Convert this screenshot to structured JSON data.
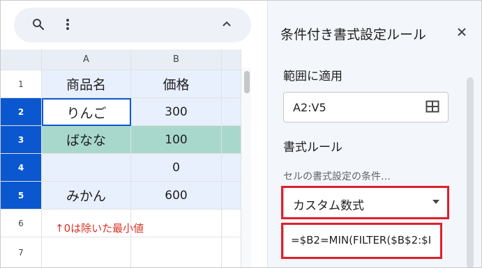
{
  "toolbar": {
    "search_icon": "search-icon",
    "more_icon": "more-vert-icon",
    "collapse_icon": "chevron-up-icon"
  },
  "sheet": {
    "columns": [
      "A",
      "B"
    ],
    "rows": [
      "1",
      "2",
      "3",
      "4",
      "5",
      "6",
      "7"
    ],
    "cells": {
      "A1": "商品名",
      "B1": "価格",
      "A2": "りんご",
      "B2": "300",
      "A3": "ばなな",
      "B3": "100",
      "A4": "",
      "B4": "0",
      "A5": "みかん",
      "B5": "600"
    },
    "note": "↑0は除いた最小値",
    "highlight_color": "#a8d8cc",
    "note_color": "#d93025"
  },
  "panel": {
    "title": "条件付き書式設定ルール",
    "range_label": "範囲に適用",
    "range_value": "A2:V5",
    "format_rules_label": "書式ルール",
    "condition_label": "セルの書式設定の条件…",
    "condition_value": "カスタム数式",
    "formula_value": "=$B2=MIN(FILTER($B$2:$I",
    "callout_color": "#e0202a"
  }
}
